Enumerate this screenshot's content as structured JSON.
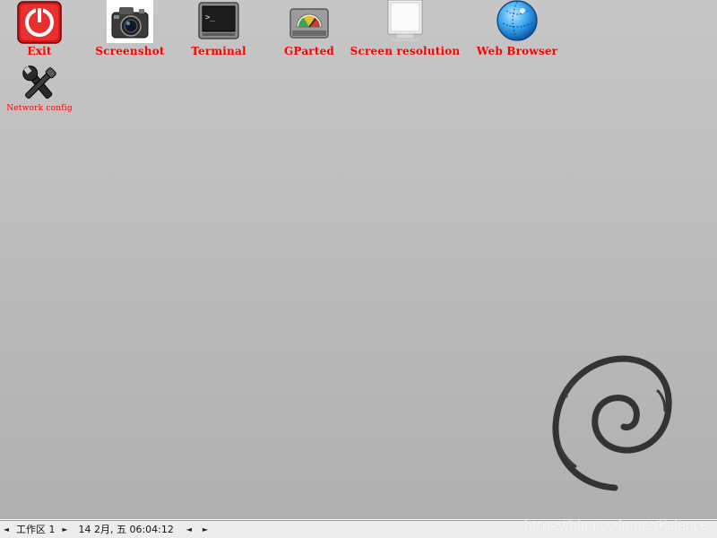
{
  "desktop": {
    "icons": [
      {
        "label": "Exit",
        "icon": "power-icon"
      },
      {
        "label": "Screenshot",
        "icon": "camera-icon"
      },
      {
        "label": "Terminal",
        "icon": "terminal-icon"
      },
      {
        "label": "GParted",
        "icon": "disk-gauge-icon"
      },
      {
        "label": "Screen resolution",
        "icon": "monitor-icon"
      },
      {
        "label": "Web Browser",
        "icon": "globe-icon"
      },
      {
        "label": "Network config",
        "icon": "tools-icon"
      }
    ],
    "label_color": "#ff0000"
  },
  "taskbar": {
    "prev_workspace_glyph": "◄",
    "workspace": "工作区 1",
    "next_workspace_glyph": "►",
    "clock": "14 2月, 五 06:04:12",
    "prev_window_glyph": "◄",
    "next_window_glyph": "►"
  },
  "watermark": "https://blog.csdn.net/Kalence",
  "background": {
    "logo": "debian-swirl-icon",
    "color": "#bcbcbc"
  }
}
